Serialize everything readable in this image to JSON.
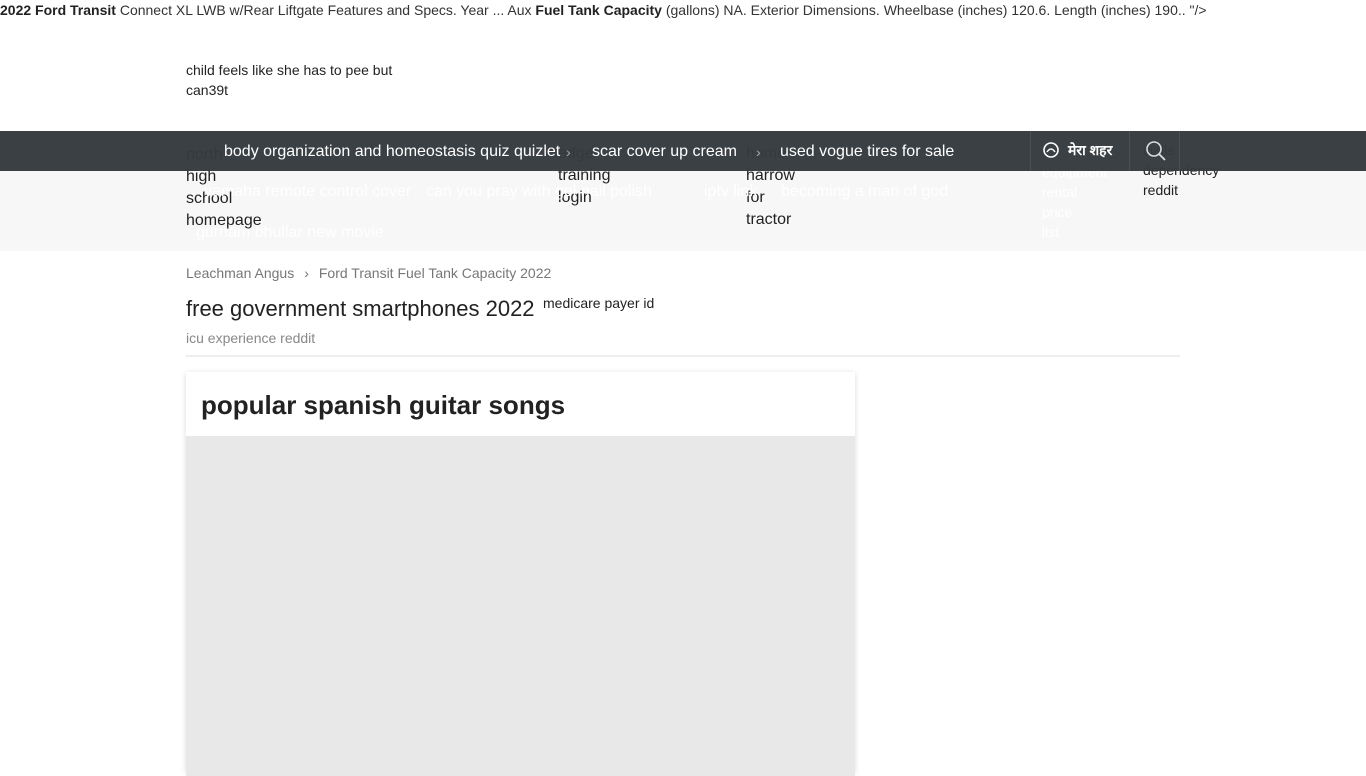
{
  "top_snippet": {
    "b1": "2022 Ford Transit",
    "t1": " Connect XL LWB w/Rear Liftgate Features and Specs. Year ... Aux ",
    "b2": "Fuel Tank Capacity",
    "t2": " (gallons) NA. Exterior Dimensions. Wheelbase (inches) 120.6. Length (inches) 190.. \"/>"
  },
  "header_text": "child feels like she has to pee but can39t",
  "under_nav": {
    "col1": [
      "north",
      "high",
      "school",
      "homepage"
    ],
    "col2": [
      "edge",
      "training",
      "login"
    ],
    "col3": [
      "home",
      "harrow",
      "for",
      "tractor"
    ],
    "col4": [
      "equipment",
      "rental",
      "price",
      "list"
    ],
    "col5": [
      "cialis",
      "dependency",
      "reddit"
    ]
  },
  "ghost_links": [
    "yamaha remote control cover",
    "can you pray with gel nail polish",
    "iptv link",
    "becoming a man of god",
    "gurnam bhullar new movie"
  ],
  "nav": {
    "links": [
      "body organization and homeostasis quiz quizlet",
      "scar cover up cream",
      "used vogue tires for sale"
    ],
    "separator": "›",
    "city_label": "मेरा शहर",
    "city_icon": "city-pin-icon",
    "search_icon": "search-icon"
  },
  "breadcrumb": [
    "Leachman Angus",
    "›",
    "Ford Transit Fuel Tank Capacity 2022"
  ],
  "title": "free government smartphones 2022",
  "title_sup": "medicare payer id",
  "subtitle": "icu experience reddit",
  "card": {
    "title": "popular spanish guitar songs"
  },
  "colors": {
    "nav_bg": "#353a3e",
    "band_bg": "#f7f7f8",
    "image_placeholder": "#e8e8e8"
  }
}
